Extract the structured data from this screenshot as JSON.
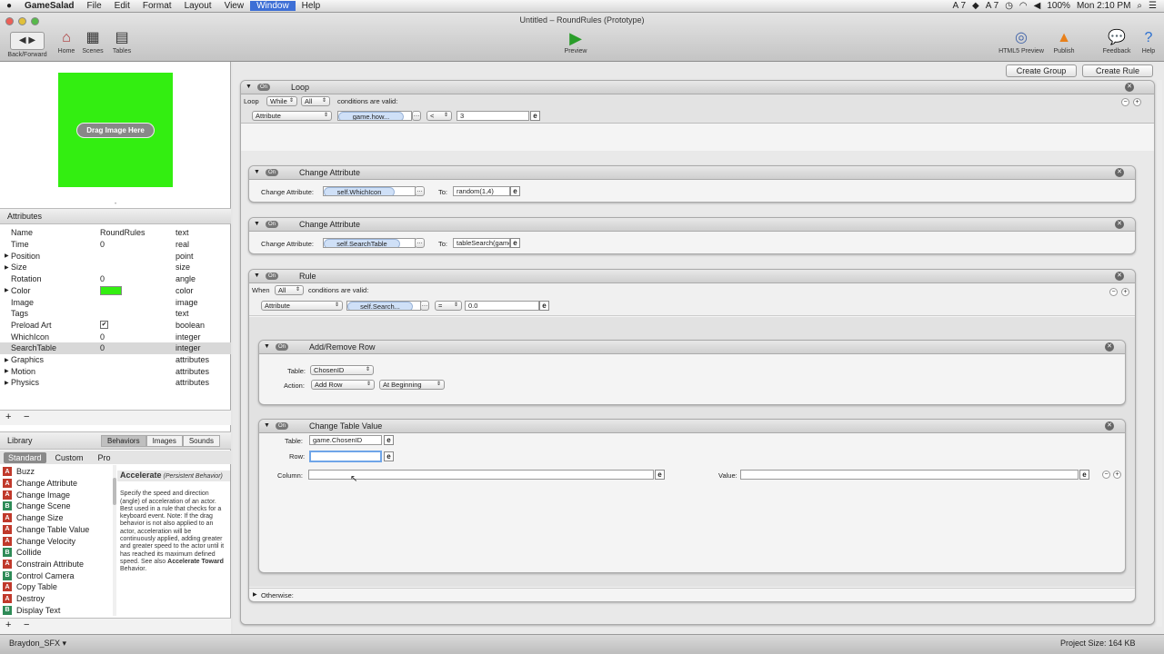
{
  "menubar": {
    "apple": "",
    "app": "GameSalad",
    "items": [
      "File",
      "Edit",
      "Format",
      "Layout",
      "View",
      "Window",
      "Help"
    ],
    "status": {
      "a": "A 7",
      "b": "A 7",
      "battery": "100%",
      "time": "Mon 2:10 PM"
    }
  },
  "window": {
    "title": "Untitled – RoundRules (Prototype)"
  },
  "toolbar": {
    "back_forward": "Back/Forward",
    "home": "Home",
    "scenes": "Scenes",
    "tables": "Tables",
    "preview": "Preview",
    "html5": "HTML5 Preview",
    "publish": "Publish",
    "feedback": "Feedback",
    "help": "Help"
  },
  "image_well": {
    "label": "Drag Image Here",
    "color": "#33ee11"
  },
  "attributes": {
    "header": "Attributes",
    "rows": [
      {
        "name": "Name",
        "value": "RoundRules",
        "type": "text"
      },
      {
        "name": "Time",
        "value": "0",
        "type": "real"
      },
      {
        "name": "Position",
        "value": "",
        "type": "point"
      },
      {
        "name": "Size",
        "value": "",
        "type": "size"
      },
      {
        "name": "Rotation",
        "value": "0",
        "type": "angle"
      },
      {
        "name": "Color",
        "value": "",
        "type": "color"
      },
      {
        "name": "Image",
        "value": "",
        "type": "image"
      },
      {
        "name": "Tags",
        "value": "",
        "type": "text"
      },
      {
        "name": "Preload Art",
        "value": "",
        "type": "boolean"
      },
      {
        "name": "WhichIcon",
        "value": "0",
        "type": "integer"
      },
      {
        "name": "SearchTable",
        "value": "0",
        "type": "integer"
      },
      {
        "name": "Graphics",
        "value": "",
        "type": "attributes"
      },
      {
        "name": "Motion",
        "value": "",
        "type": "attributes"
      },
      {
        "name": "Physics",
        "value": "",
        "type": "attributes"
      }
    ],
    "add": "+",
    "remove": "−"
  },
  "library": {
    "header": "Library",
    "tabs": [
      "Behaviors",
      "Images",
      "Sounds"
    ],
    "subtabs": [
      "Standard",
      "Custom",
      "Pro"
    ],
    "items": [
      {
        "badge": "A",
        "label": "Buzz"
      },
      {
        "badge": "A",
        "label": "Change Attribute"
      },
      {
        "badge": "A",
        "label": "Change Image"
      },
      {
        "badge": "B",
        "label": "Change Scene"
      },
      {
        "badge": "A",
        "label": "Change Size"
      },
      {
        "badge": "A",
        "label": "Change Table Value"
      },
      {
        "badge": "A",
        "label": "Change Velocity"
      },
      {
        "badge": "B",
        "label": "Collide"
      },
      {
        "badge": "A",
        "label": "Constrain Attribute"
      },
      {
        "badge": "B",
        "label": "Control Camera"
      },
      {
        "badge": "A",
        "label": "Copy Table"
      },
      {
        "badge": "A",
        "label": "Destroy"
      },
      {
        "badge": "B",
        "label": "Display Text"
      }
    ],
    "desc_title": "Accelerate",
    "desc_sub": "(Persistent Behavior)",
    "desc_body": "Specify the speed and direction (angle) of acceleration of an actor. Best used in a rule that checks for a keyboard event. Note: If the drag behavior is not also applied to an actor, acceleration will be continuously applied, adding greater and greater speed to the actor until it has reached its maximum defined speed. See also",
    "desc_link": "Accelerate Toward",
    "desc_end": "Behavior."
  },
  "bottom": {
    "user": "Braydon_SFX",
    "project_size": "Project Size: 164 KB"
  },
  "main": {
    "create_group": "Create Group",
    "create_rule": "Create Rule",
    "loop": {
      "on": "On",
      "title": "Loop",
      "cond_label": "Loop",
      "mode": "While",
      "all": "All",
      "cond_text": "conditions are valid:",
      "attr": "Attribute",
      "attr_val": "game.how...",
      "op": "<",
      "value": "3"
    },
    "ca1": {
      "on": "On",
      "title": "Change Attribute",
      "label": "Change Attribute:",
      "attr": "self.WhichIcon",
      "to": "To:",
      "value": "random(1,4)"
    },
    "ca2": {
      "on": "On",
      "title": "Change Attribute",
      "label": "Change Attribute:",
      "attr": "self.SearchTable",
      "to": "To:",
      "value": "tableSearch(game"
    },
    "rule": {
      "on": "On",
      "title": "Rule",
      "when": "When",
      "all": "All",
      "cond_text": "conditions are valid:",
      "attr": "Attribute",
      "attr_val": "self.Search...",
      "op": "=",
      "value": "0.0",
      "otherwise": "Otherwise:"
    },
    "arr": {
      "on": "On",
      "title": "Add/Remove Row",
      "table_label": "Table:",
      "table": "ChosenID",
      "action_label": "Action:",
      "action": "Add Row",
      "position": "At Beginning"
    },
    "ctv": {
      "on": "On",
      "title": "Change Table Value",
      "table_label": "Table:",
      "table": "game.ChosenID",
      "row_label": "Row:",
      "row": "",
      "col_label": "Column:",
      "col": "",
      "val_label": "Value:",
      "val": ""
    }
  }
}
